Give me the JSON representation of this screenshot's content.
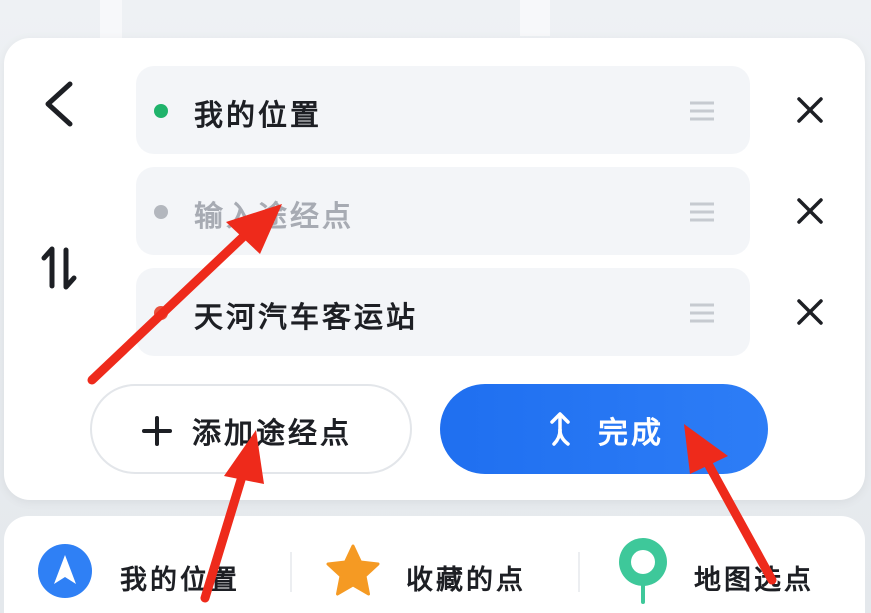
{
  "route": {
    "fields": [
      {
        "label": "我的位置",
        "dot_color": "#1fb36b",
        "is_placeholder": false
      },
      {
        "label": "输入途经点",
        "dot_color": "#b3b7be",
        "is_placeholder": true
      },
      {
        "label": "天河汽车客运站",
        "dot_color": "#e8503c",
        "is_placeholder": false
      }
    ]
  },
  "actions": {
    "add_waypoint_label": "添加途经点",
    "done_label": "完成"
  },
  "quick_bar": {
    "items": [
      {
        "label": "我的位置",
        "icon": "navigation-arrow-icon",
        "color": "#2f80f5"
      },
      {
        "label": "收藏的点",
        "icon": "star-icon",
        "color": "#f59a23"
      },
      {
        "label": "地图选点",
        "icon": "map-pin-icon",
        "color": "#3ec89a"
      }
    ]
  },
  "colors": {
    "primary": "#1f6ff0",
    "annotation": "#ee2a1b"
  }
}
